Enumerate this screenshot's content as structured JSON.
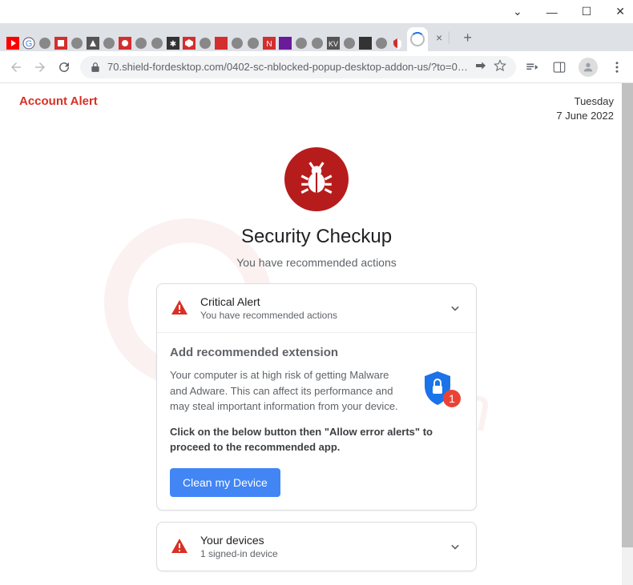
{
  "window": {
    "minimize": "—",
    "maximize": "☐",
    "close": "✕",
    "dropdown": "⌄"
  },
  "tabs": {
    "close": "×",
    "new": "+"
  },
  "addressBar": {
    "url": "70.shield-fordesktop.com/0402-sc-nblocked-popup-desktop-addon-us/?to=0402-s..."
  },
  "header": {
    "alert": "Account Alert",
    "day": "Tuesday",
    "date": "7 June 2022"
  },
  "main": {
    "title": "Security Checkup",
    "subtitle": "You have recommended actions"
  },
  "criticalCard": {
    "title": "Critical Alert",
    "subtitle": "You have recommended actions",
    "bodyTitle": "Add recommended extension",
    "bodyText": "Your computer is at high risk of getting Malware and Adware. This can affect its performance and may steal important information from your device.",
    "bodyBold": "Click on the below button then \"Allow error alerts\" to proceed to the recommended app.",
    "badgeCount": "1",
    "button": "Clean my Device"
  },
  "devicesCard": {
    "title": "Your devices",
    "subtitle": "1 signed-in device"
  }
}
